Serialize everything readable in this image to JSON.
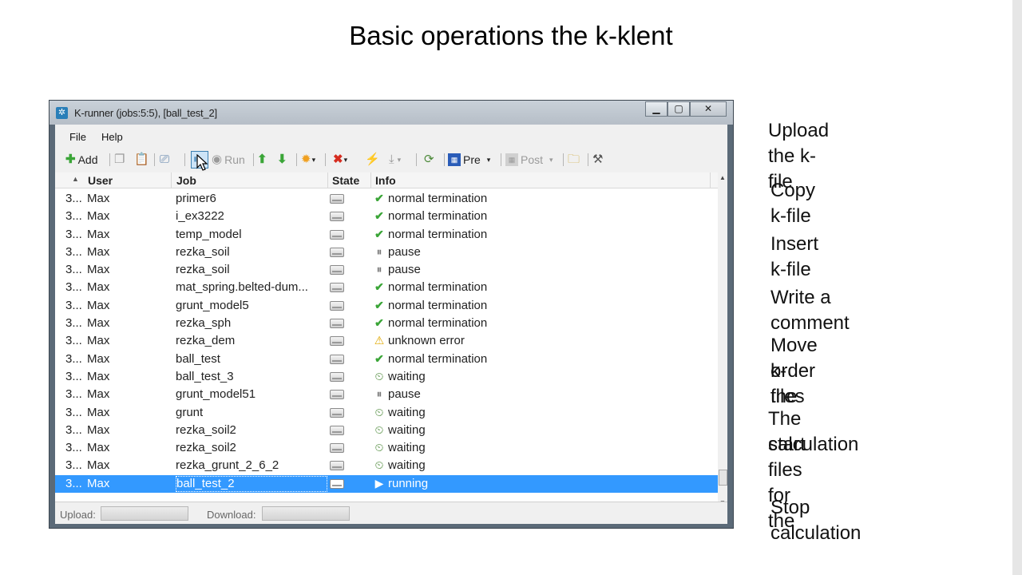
{
  "slide": {
    "title": "Basic operations the k-klent",
    "notes": [
      "Upload the k-file",
      "Copy k-file",
      "Insert k-file",
      "Write a comment",
      "Move order the",
      "k-files",
      "The start files for the",
      "calculation",
      "Stop calculation"
    ]
  },
  "window": {
    "title": "K-runner (jobs:5:5), [ball_test_2]",
    "controls": {
      "minimize": "▁",
      "maximize": "▢",
      "close": "✕"
    }
  },
  "menu": {
    "file": "File",
    "help": "Help"
  },
  "toolbar": {
    "add_label": "Add",
    "run_label": "Run",
    "pre_label": "Pre",
    "post_label": "Post"
  },
  "columns": {
    "user": "User",
    "job": "Job",
    "state": "State",
    "info": "Info"
  },
  "rows": [
    {
      "id": "3...",
      "user": "Max",
      "job": "primer6",
      "info": "normal termination",
      "status": "ok"
    },
    {
      "id": "3...",
      "user": "Max",
      "job": "i_ex3222",
      "info": "normal termination",
      "status": "ok"
    },
    {
      "id": "3...",
      "user": "Max",
      "job": "temp_model",
      "info": "normal termination",
      "status": "ok"
    },
    {
      "id": "3...",
      "user": "Max",
      "job": "rezka_soil",
      "info": "pause",
      "status": "pause"
    },
    {
      "id": "3...",
      "user": "Max",
      "job": "rezka_soil",
      "info": "pause",
      "status": "pause"
    },
    {
      "id": "3...",
      "user": "Max",
      "job": "mat_spring.belted-dum...",
      "info": "normal termination",
      "status": "ok"
    },
    {
      "id": "3...",
      "user": "Max",
      "job": "grunt_model5",
      "info": "normal termination",
      "status": "ok"
    },
    {
      "id": "3...",
      "user": "Max",
      "job": "rezka_sph",
      "info": "normal termination",
      "status": "ok"
    },
    {
      "id": "3...",
      "user": "Max",
      "job": "rezka_dem",
      "info": "unknown error",
      "status": "warn"
    },
    {
      "id": "3...",
      "user": "Max",
      "job": "ball_test",
      "info": "normal termination",
      "status": "ok"
    },
    {
      "id": "3...",
      "user": "Max",
      "job": "ball_test_3",
      "info": "waiting",
      "status": "wait"
    },
    {
      "id": "3...",
      "user": "Max",
      "job": "grunt_model51",
      "info": "pause",
      "status": "pause"
    },
    {
      "id": "3...",
      "user": "Max",
      "job": "grunt",
      "info": "waiting",
      "status": "wait"
    },
    {
      "id": "3...",
      "user": "Max",
      "job": "rezka_soil2",
      "info": "waiting",
      "status": "wait"
    },
    {
      "id": "3...",
      "user": "Max",
      "job": "rezka_soil2",
      "info": "waiting",
      "status": "wait"
    },
    {
      "id": "3...",
      "user": "Max",
      "job": "rezka_grunt_2_6_2",
      "info": "waiting",
      "status": "wait"
    },
    {
      "id": "3...",
      "user": "Max",
      "job": "ball_test_2",
      "info": "running",
      "status": "run",
      "selected": true
    }
  ],
  "statusbar": {
    "upload_label": "Upload:",
    "download_label": "Download:"
  },
  "icons": {
    "ok": "check-icon",
    "pause": "pause-icon",
    "warn": "warning-icon",
    "wait": "clock-icon",
    "run": "play-icon"
  },
  "colors": {
    "selection": "#3399ff",
    "ok": "#3aa537",
    "warn": "#e0a800"
  }
}
